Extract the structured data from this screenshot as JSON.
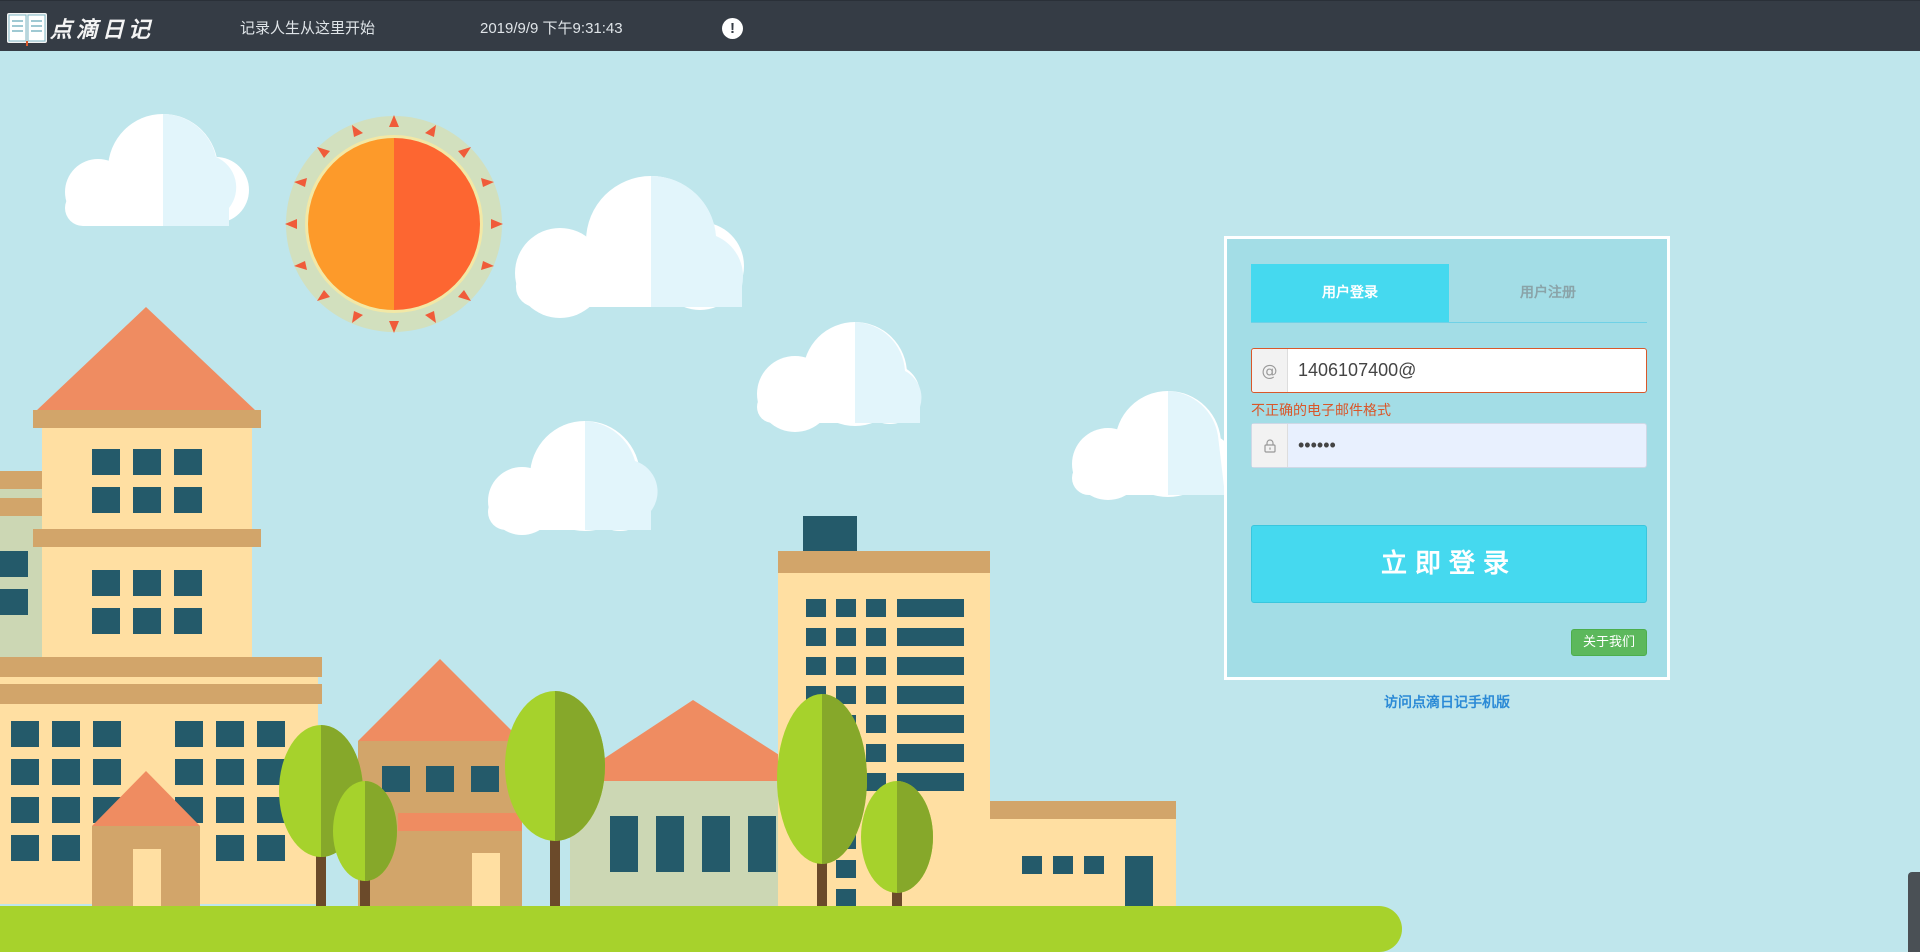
{
  "header": {
    "logo_text": "点滴日记",
    "slogan": "记录人生从这里开始",
    "datetime": "2019/9/9 下午9:31:43",
    "alert_icon": "!"
  },
  "login": {
    "tabs": [
      {
        "label": "用户登录",
        "active": true
      },
      {
        "label": "用户注册",
        "active": false
      }
    ],
    "email": {
      "icon": "@",
      "value": "1406107400@"
    },
    "email_error": "不正确的电子邮件格式",
    "password": {
      "icon": "lock-icon",
      "value": "123456"
    },
    "submit_label": "立即登录",
    "about_label": "关于我们"
  },
  "mobile_link": "访问点滴日记手机版",
  "colors": {
    "header_bg": "#353c45",
    "sky": "#bfe6ec",
    "accent": "#45d9ef",
    "error": "#d9572a",
    "about_btn": "#5cb85c",
    "ground": "#a7d22c"
  }
}
